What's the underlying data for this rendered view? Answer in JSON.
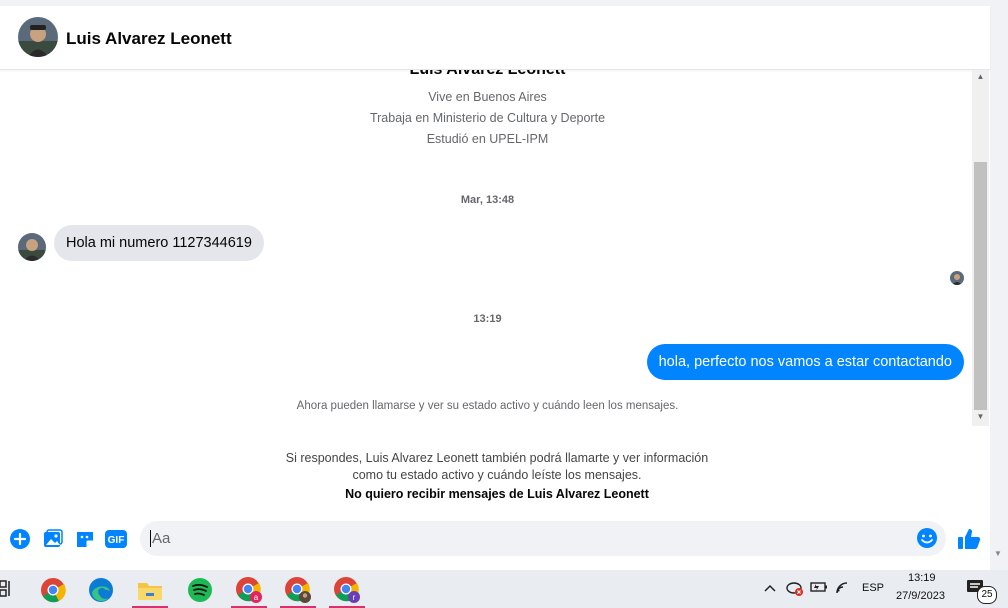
{
  "header": {
    "contact_name": "Luis Alvarez Leonett"
  },
  "profile": {
    "name": "Luis Alvarez Leonett",
    "lines": [
      "Vive en Buenos Aires",
      "Trabaja en Ministerio de Cultura y Deporte",
      "Estudió en UPEL-IPM"
    ]
  },
  "conversation": {
    "timestamp_1": "Mar, 13:48",
    "incoming_message": "Hola mi numero 1127344619",
    "timestamp_2": "13:19",
    "outgoing_message": "hola, perfecto nos vamos a estar contactando",
    "info": "Ahora pueden llamarse y ver su estado activo y cuándo leen los mensajes."
  },
  "notice": {
    "line_1": "Si respondes, Luis Alvarez Leonett también podrá llamarte y ver información",
    "line_2": "como tu estado activo y cuándo leíste los mensajes.",
    "link": "No quiero recibir mensajes de Luis Alvarez Leonett"
  },
  "composer": {
    "placeholder": "Aa",
    "icons": [
      "plus-icon",
      "image-icon",
      "sticker-icon",
      "gif-icon",
      "emoji-icon",
      "like-icon"
    ],
    "gif_label": "GIF"
  },
  "taskbar": {
    "apps": [
      "chrome-icon",
      "edge-icon",
      "file-explorer-icon",
      "spotify-icon",
      "chrome-profile-a-icon",
      "chrome-profile-icon",
      "chrome-profile-r-icon"
    ],
    "profile_a_letter": "a",
    "profile_r_letter": "r",
    "language": "ESP",
    "time": "13:19",
    "date": "27/9/2023",
    "notifications": "25"
  },
  "colors": {
    "accent": "#0084ff",
    "incoming_bubble": "#e4e6eb",
    "taskbar_highlight": "#d6336c"
  }
}
